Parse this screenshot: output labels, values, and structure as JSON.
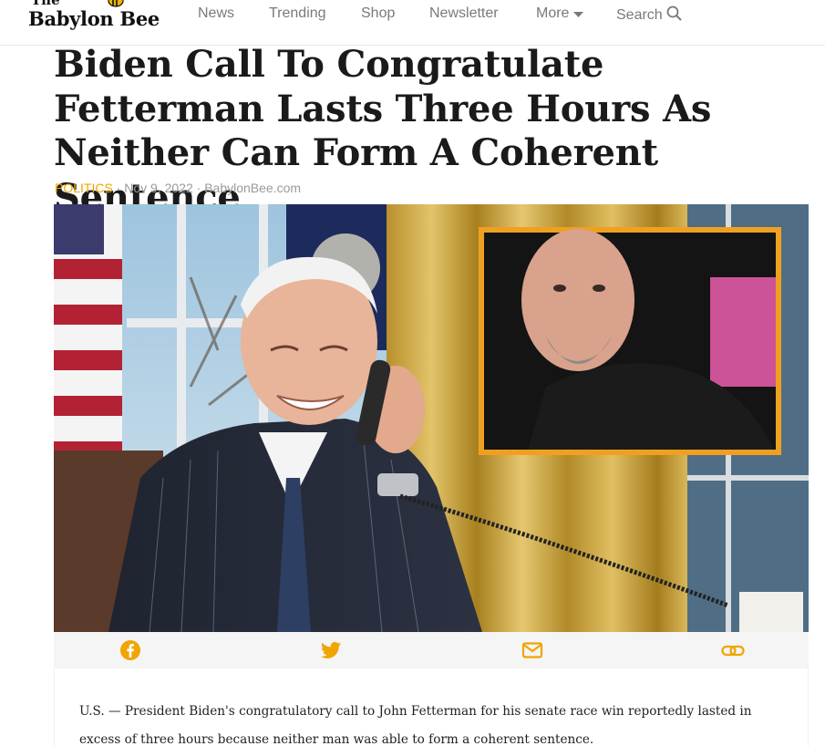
{
  "site": {
    "logo_top": "The",
    "logo_name": "Babylon Bee"
  },
  "nav": {
    "items": [
      {
        "label": "News"
      },
      {
        "label": "Trending"
      },
      {
        "label": "Shop"
      },
      {
        "label": "Newsletter"
      },
      {
        "label": "More"
      },
      {
        "label": "Search"
      }
    ]
  },
  "article": {
    "title": "Biden Call To Congratulate Fetterman Lasts Three Hours As Neither Can Form A Coherent Sentence",
    "category": "POLITICS",
    "date": "Nov 9, 2022",
    "source": "BabylonBee.com",
    "separator": " · ",
    "body": "U.S. — President Biden's congratulatory call to John Fetterman for his senate race win reportedly lasted in excess of three hours because neither man was able to form a coherent sentence."
  },
  "share": {
    "buttons": [
      {
        "name": "facebook-icon"
      },
      {
        "name": "twitter-icon"
      },
      {
        "name": "email-icon"
      },
      {
        "name": "link-icon"
      }
    ],
    "color": "#f0a500"
  },
  "colors": {
    "accent": "#f0a500",
    "nav_text": "#7a7a7a",
    "meta_text": "#9a9a9a"
  }
}
